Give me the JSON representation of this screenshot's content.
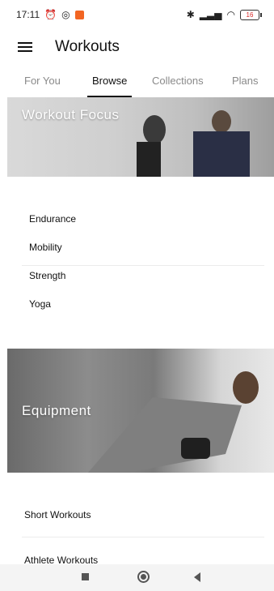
{
  "status_bar": {
    "time": "17:11",
    "battery": "16",
    "icons": [
      "alarm-off-icon",
      "whatsapp-icon",
      "app-notification-icon",
      "bluetooth-icon",
      "signal-icon",
      "wifi-icon",
      "battery-icon"
    ]
  },
  "header": {
    "title": "Workouts"
  },
  "tabs": [
    {
      "label": "For You"
    },
    {
      "label": "Browse",
      "active": true
    },
    {
      "label": "Collections"
    },
    {
      "label": "Plans"
    }
  ],
  "workout_focus": {
    "title": "Workout Focus",
    "items": [
      "Endurance",
      "Mobility",
      "Strength",
      "Yoga"
    ]
  },
  "equipment": {
    "title": "Equipment"
  },
  "bottom_list": {
    "items": [
      "Short Workouts",
      "Athlete Workouts"
    ]
  },
  "colors": {
    "accent": "#111111",
    "tab_inactive": "#8a8a8a",
    "battery_low": "#d92a2a",
    "app_icon": "#f26522"
  }
}
